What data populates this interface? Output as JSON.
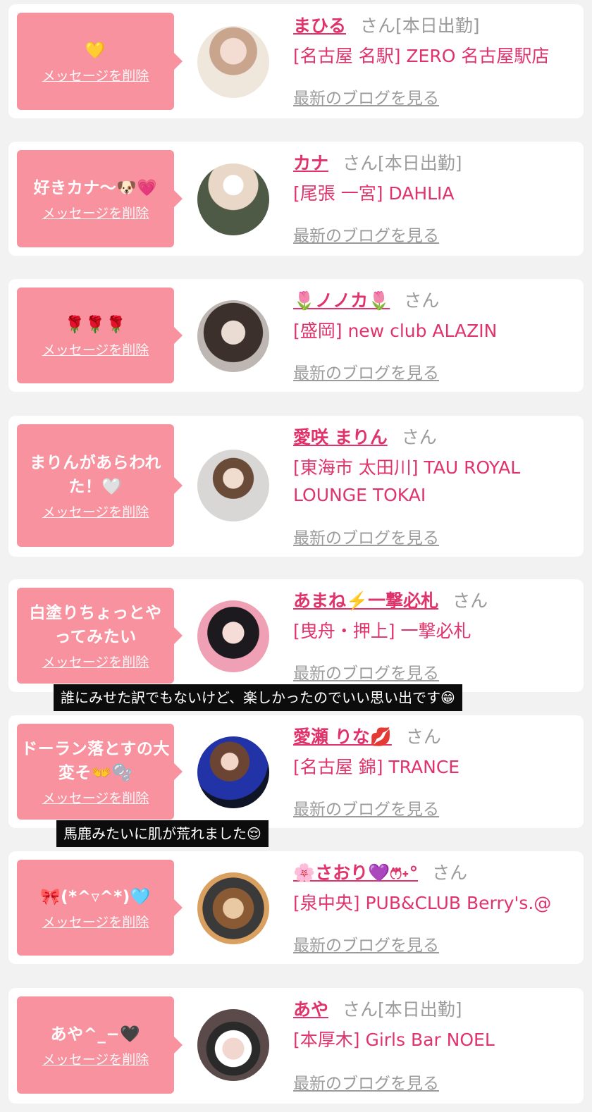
{
  "delete_label": "メッセージを削除",
  "blog_label": "最新のブログを見る",
  "san": "さん",
  "cards": [
    {
      "message": "💛",
      "name": "まひる",
      "status": "[本日出勤]",
      "shop": "[名古屋 名駅] ZERO 名古屋駅店"
    },
    {
      "message": "好きカナ〜🐶💗",
      "name": "カナ",
      "status": "[本日出勤]",
      "shop": "[尾張 一宮] DAHLIA"
    },
    {
      "message": "🌹🌹🌹",
      "name": "🌷ノノカ🌷",
      "status": "",
      "shop": "[盛岡] new club ALAZIN"
    },
    {
      "message": "まりんがあらわれた！🤍",
      "name": "愛咲 まりん",
      "status": "",
      "shop": "[東海市 太田川] TAU ROYAL LOUNGE TOKAI"
    },
    {
      "message": "白塗りちょっとやってみたい",
      "name": "あまね⚡️一撃必札",
      "status": "",
      "shop": "[曳舟・押上] 一撃必札"
    },
    {
      "message": "ドーラン落とすの大変そ👐🫧",
      "name": "愛瀬 りな💋",
      "status": "",
      "shop": "[名古屋 錦] TRANCE"
    },
    {
      "message": "🎀(*^▿^*)🩵",
      "name": "🌸さおり💜ෆ⃛˖°",
      "status": "",
      "shop": "[泉中央] PUB&CLUB Berry's.@"
    },
    {
      "message": "あや^_−🖤",
      "name": "あや",
      "status": "[本日出勤]",
      "shop": "[本厚木] Girls Bar NOEL"
    }
  ],
  "captions": [
    "誰にみせた訳でもないけど、楽しかったのでいい思い出です😁",
    "馬鹿みたいに肌が荒れました😌"
  ]
}
